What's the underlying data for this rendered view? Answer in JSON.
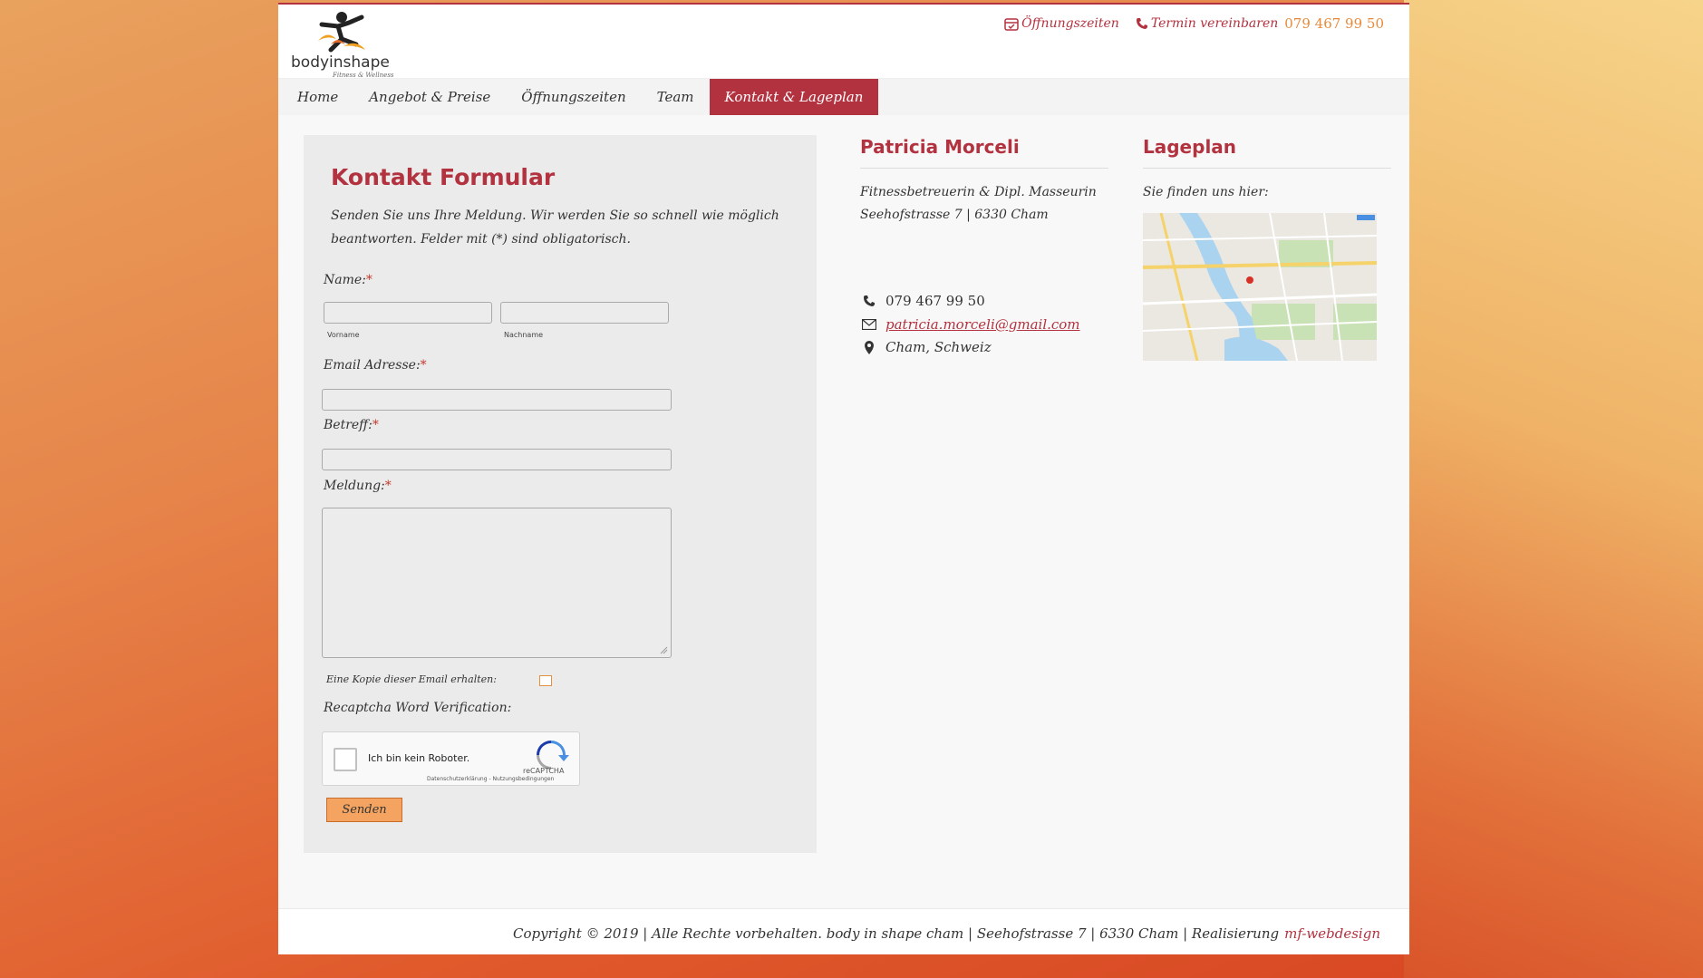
{
  "header": {
    "logo_text": "bodyinshape",
    "logo_subtitle": "Fitness & Wellness",
    "topbar": {
      "opening_hours": "Öffnungszeiten",
      "appointment": "Termin vereinbaren",
      "phone": "079 467 99 50"
    }
  },
  "nav": {
    "items": [
      {
        "label": "Home"
      },
      {
        "label": "Angebot & Preise"
      },
      {
        "label": "Öffnungszeiten"
      },
      {
        "label": "Team"
      },
      {
        "label": "Kontakt & Lageplan"
      }
    ],
    "active_index": 4
  },
  "form": {
    "title": "Kontakt Formular",
    "intro": "Senden Sie uns Ihre Meldung. Wir werden Sie so schnell wie möglich beantworten. Felder mit (*) sind obligatorisch.",
    "name_label": "Name:",
    "first_name_sublabel": "Vorname",
    "last_name_sublabel": "Nachname",
    "email_label": "Email Adresse:",
    "subject_label": "Betreff:",
    "message_label": "Meldung:",
    "required_marker": "*",
    "copy_label": "Eine Kopie dieser Email erhalten:",
    "captcha_label": "Recaptcha Word Verification:",
    "captcha_text": "Ich bin kein Roboter.",
    "captcha_brand": "reCAPTCHA",
    "captcha_links": "Datenschutzerklärung - Nutzungsbedingungen",
    "submit_label": "Senden"
  },
  "contact": {
    "title": "Patricia Morceli",
    "role": "Fitnessbetreuerin & Dipl. Masseurin",
    "address": "Seehofstrasse 7 | 6330 Cham",
    "phone": "079 467 99 50",
    "email": "patricia.morceli@gmail.com",
    "location": "Cham, Schweiz"
  },
  "map_section": {
    "title": "Lageplan",
    "subtitle": "Sie finden uns hier:"
  },
  "footer": {
    "text": "Copyright © 2019 | Alle Rechte vorbehalten. body in shape cham | Seehofstrasse 7 | 6330 Cham | Realisierung",
    "link": "mf-webdesign"
  },
  "colors": {
    "brand": "#b3323f",
    "accent_orange": "#e88a3a",
    "button": "#f4a460"
  }
}
